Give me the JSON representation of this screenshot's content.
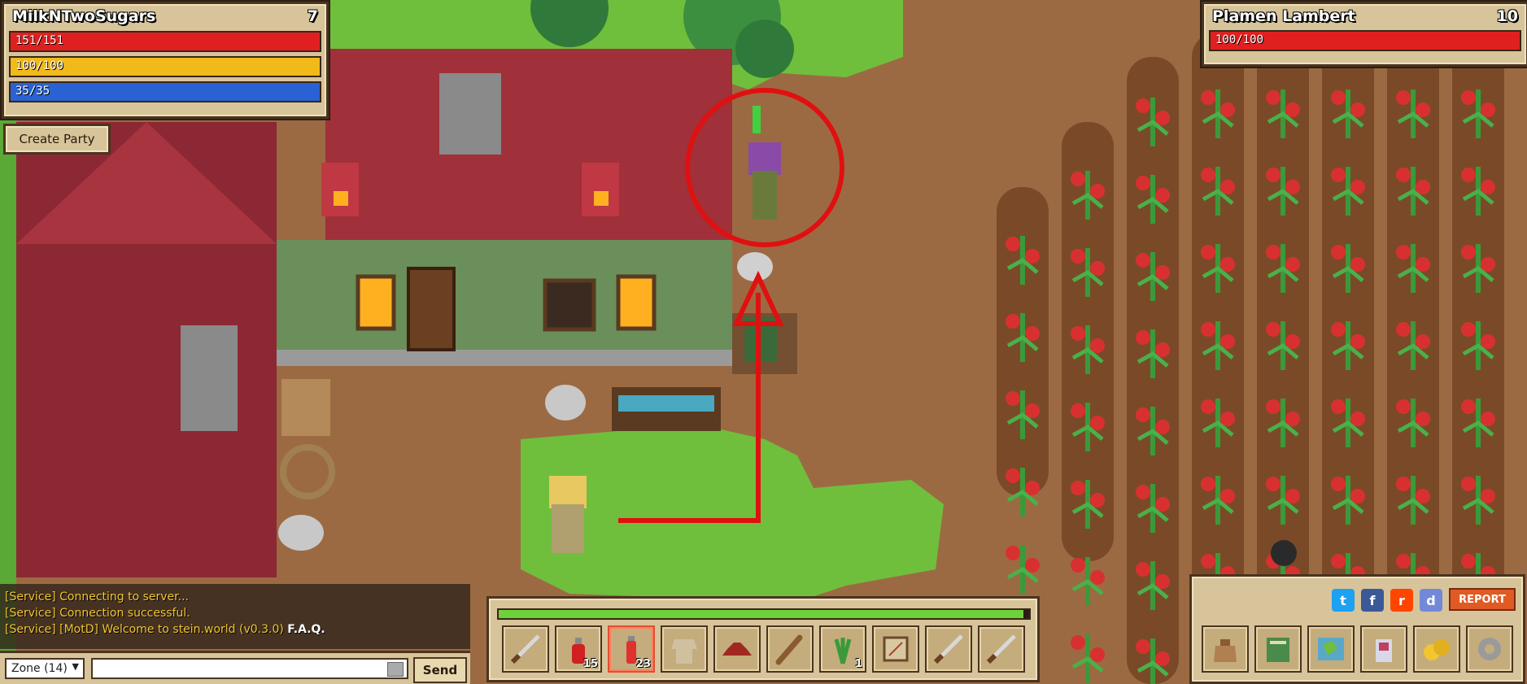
{
  "player": {
    "name": "MilkNTwoSugars",
    "level": "7",
    "health": {
      "text": "151/151",
      "fraction": 1.0,
      "color": "#e02020"
    },
    "stamina": {
      "text": "100/100",
      "fraction": 1.0,
      "color": "#f2b91a"
    },
    "mana": {
      "text": "35/35",
      "fraction": 1.0,
      "color": "#2a62d4"
    }
  },
  "target": {
    "name": "Plamen Lambert",
    "level": "10",
    "health": {
      "text": "100/100",
      "fraction": 1.0,
      "color": "#e02020"
    }
  },
  "party": {
    "create_label": "Create Party"
  },
  "chat": {
    "lines": [
      "[Service] Connecting to server...",
      "[Service] Connection successful.",
      "[Service] [MotD] Welcome to stein.world (v0.3.0)"
    ],
    "faq_link": "F.A.Q.",
    "zone_selected": "Zone (14)",
    "input_value": "",
    "input_placeholder": "",
    "send_label": "Send"
  },
  "hotbar": {
    "xp_fraction": 0.99,
    "slots": [
      {
        "icon": "sword-icon",
        "count": ""
      },
      {
        "icon": "health-potion-icon",
        "count": "15"
      },
      {
        "icon": "red-potion-icon",
        "count": "23",
        "active": true
      },
      {
        "icon": "tunic-icon",
        "count": ""
      },
      {
        "icon": "hat-icon",
        "count": ""
      },
      {
        "icon": "club-icon",
        "count": ""
      },
      {
        "icon": "herb-icon",
        "count": "1"
      },
      {
        "icon": "map-scroll-icon",
        "count": ""
      },
      {
        "icon": "sword-icon",
        "count": ""
      },
      {
        "icon": "sword-icon",
        "count": ""
      }
    ]
  },
  "menu": {
    "social": [
      {
        "icon": "twitter-icon",
        "glyph": "t",
        "color": "#1da1f2"
      },
      {
        "icon": "facebook-icon",
        "glyph": "f",
        "color": "#3b5998"
      },
      {
        "icon": "reddit-icon",
        "glyph": "r",
        "color": "#ff4500"
      },
      {
        "icon": "discord-icon",
        "glyph": "d",
        "color": "#7289da"
      }
    ],
    "report_label": "REPORT",
    "buttons": [
      "inventory-bag-icon",
      "quest-book-icon",
      "world-map-icon",
      "character-icon",
      "gold-coins-icon",
      "settings-gear-icon"
    ]
  },
  "colors": {
    "grass": "#6fbf3c",
    "dirt": "#9c6a42",
    "roof": "#a0303a",
    "annotation": "#e01010"
  }
}
